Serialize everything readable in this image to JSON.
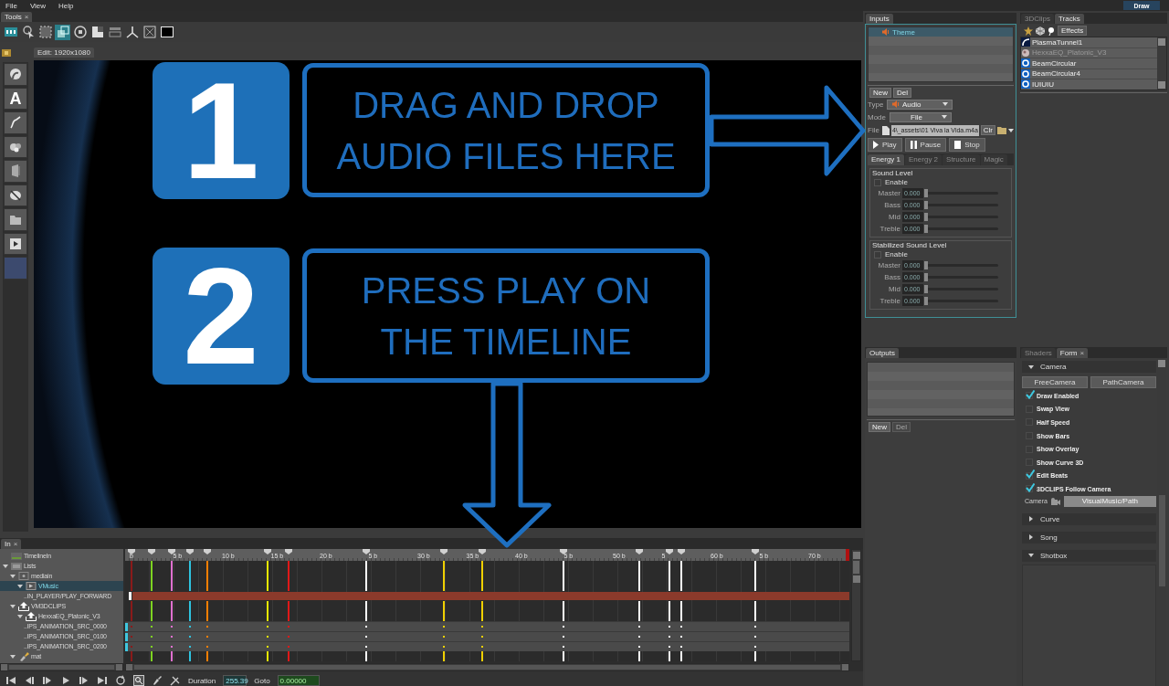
{
  "menu": [
    "File",
    "View",
    "Help"
  ],
  "draw_button": "Draw",
  "tools_tab": {
    "label": "Tools",
    "close": "×"
  },
  "toolbar": [
    {
      "selected": false
    },
    {
      "selected": false
    },
    {
      "selected": false
    },
    {
      "selected": true
    },
    {
      "selected": false
    },
    {
      "selected": false
    },
    {
      "selected": false
    },
    {
      "selected": false
    },
    {
      "selected": false
    },
    {
      "selected": false
    }
  ],
  "text_tool": "A",
  "editor_tab": "Edit: 1920x1080",
  "overlay": {
    "steps": [
      {
        "number": "1",
        "lines": [
          "DRAG AND DROP",
          "AUDIO FILES HERE"
        ]
      },
      {
        "number": "2",
        "lines": [
          "PRESS PLAY ON",
          "THE TIMELINE"
        ]
      }
    ]
  },
  "timeline": {
    "tab": {
      "label": "In",
      "close": "×"
    },
    "tree": [
      {
        "label": "TimelineIn",
        "kind": "timeline",
        "selected": false
      },
      {
        "label": "Lists",
        "kind": "folder",
        "selected": false,
        "expanded": true,
        "children": [
          {
            "label": "mediain",
            "kind": "media",
            "selected": false,
            "expanded": true,
            "children": [
              {
                "label": "VMusic",
                "kind": "video",
                "selected": true,
                "expanded": true,
                "children": [
                  {
                    "label": "..IN_PLAYER/PLAY_FORWARD",
                    "kind": "clip",
                    "selected": false
                  }
                ]
              }
            ]
          },
          {
            "label": "VM3DCLIPS",
            "kind": "clips",
            "selected": false,
            "expanded": true,
            "children": [
              {
                "label": "HexxaEQ_Platonic_V3",
                "kind": "clips",
                "selected": false,
                "expanded": true,
                "children": [
                  {
                    "label": "..IPS_ANIMATION_SRC_0000",
                    "kind": "param",
                    "selected": false
                  },
                  {
                    "label": "..IPS_ANIMATION_SRC_0100",
                    "kind": "param",
                    "selected": false
                  },
                  {
                    "label": "..IPS_ANIMATION_SRC_0200",
                    "kind": "param",
                    "selected": false
                  }
                ]
              }
            ]
          },
          {
            "label": "mat",
            "kind": "material",
            "selected": false,
            "expanded": true
          }
        ]
      }
    ],
    "ruler": [
      "b",
      "5 b",
      "10 b",
      "15 b",
      "20 b",
      "5 b",
      "30 b",
      "35 b",
      "40 b",
      "5 b",
      "50 b",
      "5",
      "60 b",
      "5 b",
      "70 b"
    ],
    "beats": [
      {
        "color": "#8a1a1a"
      },
      {
        "color": "#7ed321"
      },
      {
        "color": "#e070d0"
      },
      {
        "color": "#2ec4e0"
      },
      {
        "color": "#ff7f00"
      },
      {
        "color": "#e6e600"
      },
      {
        "color": "#e01818"
      },
      {
        "color": "#ffffff"
      },
      {
        "color": "#f0d000"
      },
      {
        "color": "#f0d000"
      },
      {
        "color": "#ffffff"
      },
      {
        "color": "#ffffff"
      },
      {
        "color": "#ffffff"
      },
      {
        "color": "#ffffff"
      },
      {
        "color": "#ffffff"
      }
    ],
    "duration_label": "Duration",
    "duration": "255.39",
    "goto_label": "Goto",
    "goto": "0.00000"
  },
  "inputs": {
    "tab": "Inputs",
    "items": [
      {
        "label": "Theme",
        "selected": true
      }
    ],
    "buttons": [
      {
        "label": "New",
        "disabled": false
      },
      {
        "label": "Del",
        "disabled": false
      }
    ],
    "type_label": "Type",
    "type": "Audio",
    "mode_label": "Mode",
    "mode": "File",
    "file_label": "File",
    "file": "4\\_assets\\01 Viva la Vida.m4a",
    "clear": "Clr",
    "transport": [
      "Play",
      "Pause",
      "Stop"
    ],
    "tabs": [
      {
        "label": "Energy 1",
        "selected": true
      },
      {
        "label": "Energy 2",
        "selected": false
      },
      {
        "label": "Structure",
        "selected": false
      },
      {
        "label": "Magic",
        "selected": false
      }
    ],
    "groups": [
      {
        "title": "Sound Level",
        "enable": {
          "label": "Enable",
          "checked": false
        },
        "sliders": [
          {
            "label": "Master",
            "value": "0.000",
            "level": 0
          },
          {
            "label": "Bass",
            "value": "0.000",
            "level": 0
          },
          {
            "label": "Mid",
            "value": "0.000",
            "level": 0
          },
          {
            "label": "Treble",
            "value": "0.000",
            "level": 0
          }
        ]
      },
      {
        "title": "Stabilized Sound Level",
        "enable": {
          "label": "Enable",
          "checked": false
        },
        "sliders": [
          {
            "label": "Master",
            "value": "0.000",
            "level": 0
          },
          {
            "label": "Bass",
            "value": "0.000",
            "level": 0
          },
          {
            "label": "Mid",
            "value": "0.000",
            "level": 0
          },
          {
            "label": "Treble",
            "value": "0.000",
            "level": 0
          }
        ]
      }
    ]
  },
  "outputs": {
    "tab": "Outputs",
    "buttons": [
      {
        "label": "New",
        "disabled": false
      },
      {
        "label": "Del",
        "disabled": true
      }
    ]
  },
  "tracks": {
    "tabs": [
      {
        "label": "3DClips",
        "selected": false
      },
      {
        "label": "Tracks",
        "selected": true
      }
    ],
    "effects": "Effects",
    "items": [
      {
        "label": "PlasmaTunnel1",
        "kind": "tunnel",
        "disabled": false
      },
      {
        "label": "HexxaEQ_Platonic_V3",
        "kind": "model",
        "disabled": true
      },
      {
        "label": "BeamCircular",
        "kind": "ring",
        "disabled": false
      },
      {
        "label": "BeamCircular4",
        "kind": "ring",
        "disabled": false
      },
      {
        "label": "IUIUIU",
        "kind": "ring",
        "disabled": false
      }
    ]
  },
  "form": {
    "tabs": [
      {
        "label": "Shaders",
        "selected": false
      },
      {
        "label": "Form",
        "selected": true,
        "close": "×"
      }
    ],
    "sections": [
      {
        "title": "Camera",
        "expanded": true,
        "buttons": [
          "FreeCamera",
          "PathCamera"
        ],
        "options": [
          {
            "label": "Draw Enabled",
            "checked": true
          },
          {
            "label": "Swap View",
            "checked": false
          },
          {
            "label": "Half Speed",
            "checked": false
          },
          {
            "label": "Show Bars",
            "checked": false
          },
          {
            "label": "Show Overlay",
            "checked": false
          },
          {
            "label": "Show Curve 3D",
            "checked": false
          },
          {
            "label": "Edit Beats",
            "checked": true
          },
          {
            "label": "3DCLIPS Follow Camera",
            "checked": true
          }
        ],
        "camera_label": "Camera",
        "camera_path": "VisualMusic/Path"
      },
      {
        "title": "Curve",
        "expanded": false
      },
      {
        "title": "Song",
        "expanded": false
      },
      {
        "title": "Shotbox",
        "expanded": true
      }
    ]
  }
}
